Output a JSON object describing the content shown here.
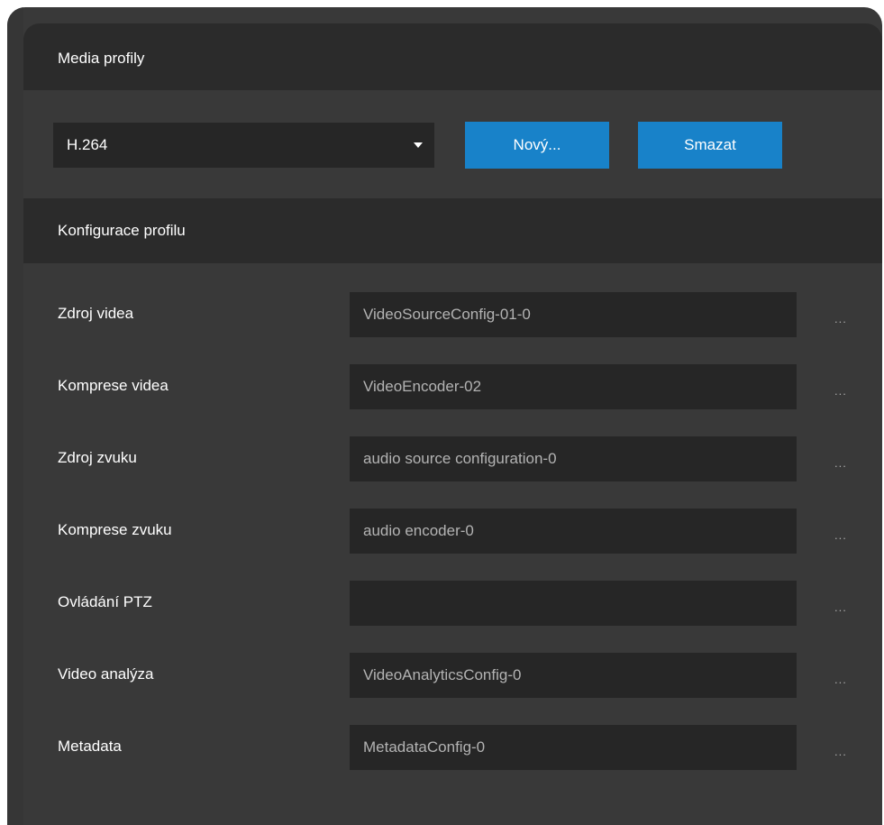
{
  "media_profiles": {
    "header": "Media profily",
    "selected_profile": "H.264",
    "new_button": "Nový...",
    "delete_button": "Smazat"
  },
  "profile_config": {
    "header": "Konfigurace profilu",
    "rows": [
      {
        "label": "Zdroj videa",
        "value": "VideoSourceConfig-01-0",
        "more": "..."
      },
      {
        "label": "Komprese videa",
        "value": "VideoEncoder-02",
        "more": "..."
      },
      {
        "label": "Zdroj zvuku",
        "value": "audio source configuration-0",
        "more": "..."
      },
      {
        "label": "Komprese zvuku",
        "value": "audio encoder-0",
        "more": "..."
      },
      {
        "label": "Ovládání PTZ",
        "value": "",
        "more": "..."
      },
      {
        "label": "Video analýza",
        "value": "VideoAnalyticsConfig-0",
        "more": "..."
      },
      {
        "label": "Metadata",
        "value": "MetadataConfig-0",
        "more": "..."
      }
    ]
  },
  "colors": {
    "panel_bg": "#393939",
    "header_bg": "#2b2b2b",
    "field_bg": "#262626",
    "accent": "#1882c9",
    "text": "#ffffff",
    "muted_text": "#b3b3b3"
  },
  "icons": {
    "dropdown": "caret-down-icon"
  }
}
